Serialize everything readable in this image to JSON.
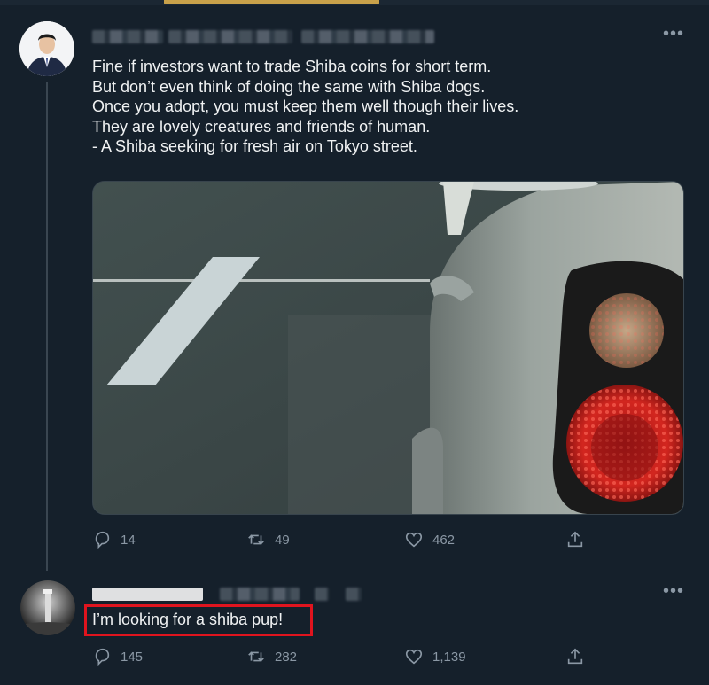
{
  "tweet": {
    "lines": [
      "Fine if investors want to trade Shiba coins for short term.",
      "But don’t even think of doing the same with Shiba dogs.",
      "Once you adopt, you must keep them well though their lives.",
      "They are lovely creatures and friends of human.",
      "- A Shiba seeking for fresh air on Tokyo street."
    ],
    "replies": "14",
    "retweets": "49",
    "likes": "462",
    "more_icon": "ellipsis-icon"
  },
  "reply": {
    "text": "I’m looking for a shiba pup!",
    "replies": "145",
    "retweets": "282",
    "likes": "1,139",
    "more_icon": "ellipsis-icon"
  },
  "icons": [
    "reply-icon",
    "retweet-icon",
    "like-icon",
    "share-icon",
    "ellipsis-icon"
  ],
  "colors": {
    "background": "#15202b",
    "text": "#e7e9ea",
    "muted": "#8b98a5",
    "highlight_border": "#e0141e"
  }
}
